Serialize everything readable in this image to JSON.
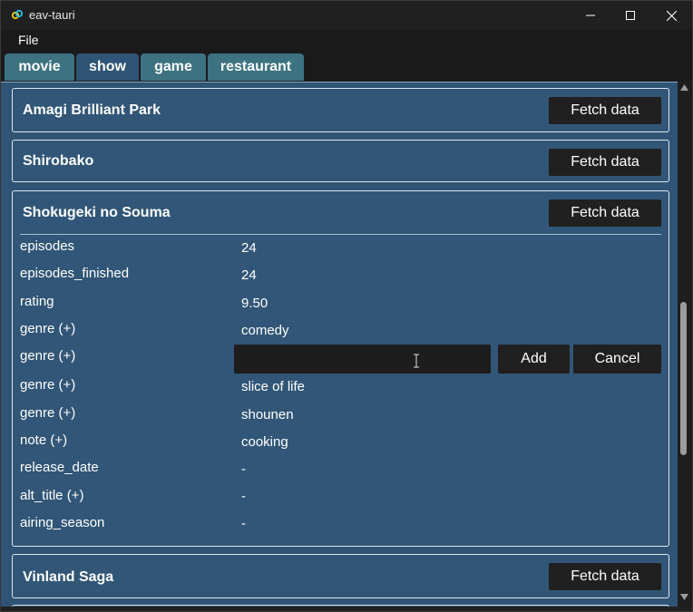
{
  "window": {
    "title": "eav-tauri"
  },
  "menu": {
    "file": "File"
  },
  "tabs": [
    "movie",
    "show",
    "game",
    "restaurant"
  ],
  "cards": [
    {
      "title": "Amagi Brilliant Park",
      "fetch_label": "Fetch data"
    },
    {
      "title": "Shirobako",
      "fetch_label": "Fetch data"
    },
    {
      "title": "Shokugeki no Souma",
      "fetch_label": "Fetch data",
      "fields": [
        {
          "name": "episodes",
          "value": "24"
        },
        {
          "name": "episodes_finished",
          "value": "24"
        },
        {
          "name": "rating",
          "value": "9.50"
        },
        {
          "name": "genre (+)",
          "value": "comedy"
        },
        {
          "name": "genre (+)",
          "value": ""
        },
        {
          "name": "genre (+)",
          "value": "slice of life"
        },
        {
          "name": "genre (+)",
          "value": "shounen"
        },
        {
          "name": "note (+)",
          "value": "cooking"
        },
        {
          "name": "release_date",
          "value": "-"
        },
        {
          "name": "alt_title (+)",
          "value": "-"
        },
        {
          "name": "airing_season",
          "value": "-"
        }
      ],
      "editor": {
        "input_value": "",
        "add_label": "Add",
        "cancel_label": "Cancel"
      }
    },
    {
      "title": "Vinland Saga",
      "fetch_label": "Fetch data"
    }
  ],
  "colors": {
    "panel": "#2f5475",
    "tab_teal": "#3d7281",
    "button": "#202020"
  }
}
